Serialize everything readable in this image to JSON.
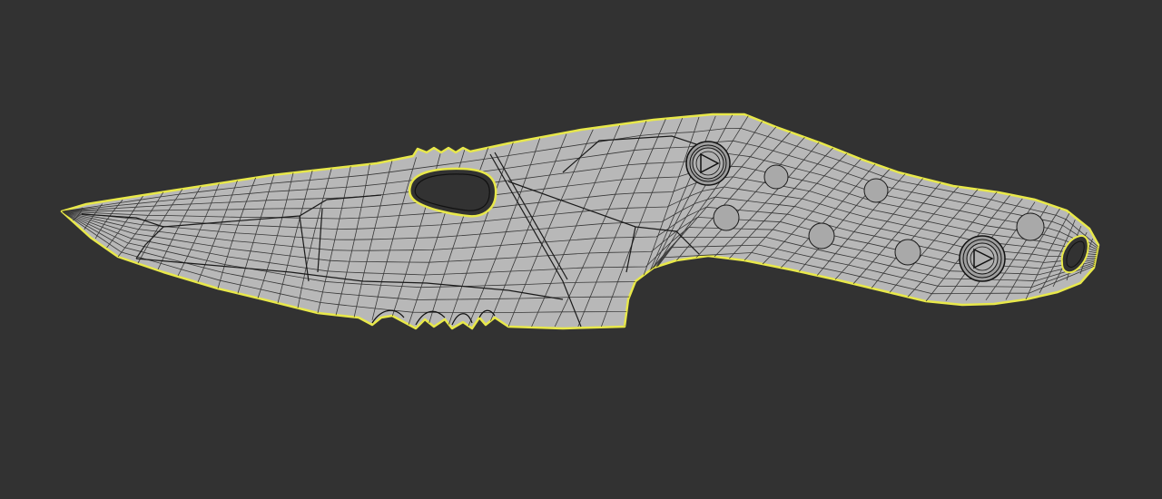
{
  "viewport": {
    "background_color": "#323232",
    "selection_outline_color": "#e8e84a",
    "mesh_fill_color": "#b9b9b9",
    "wire_color": "#1e1e1e"
  },
  "model": {
    "name": "",
    "selected": true,
    "display_mode": "shaded-wireframe",
    "parts": [
      "blade-mesh",
      "handle-mesh",
      "finger-hole",
      "serrations",
      "pivot-screw",
      "butt-screw",
      "lanyard-hole"
    ]
  }
}
